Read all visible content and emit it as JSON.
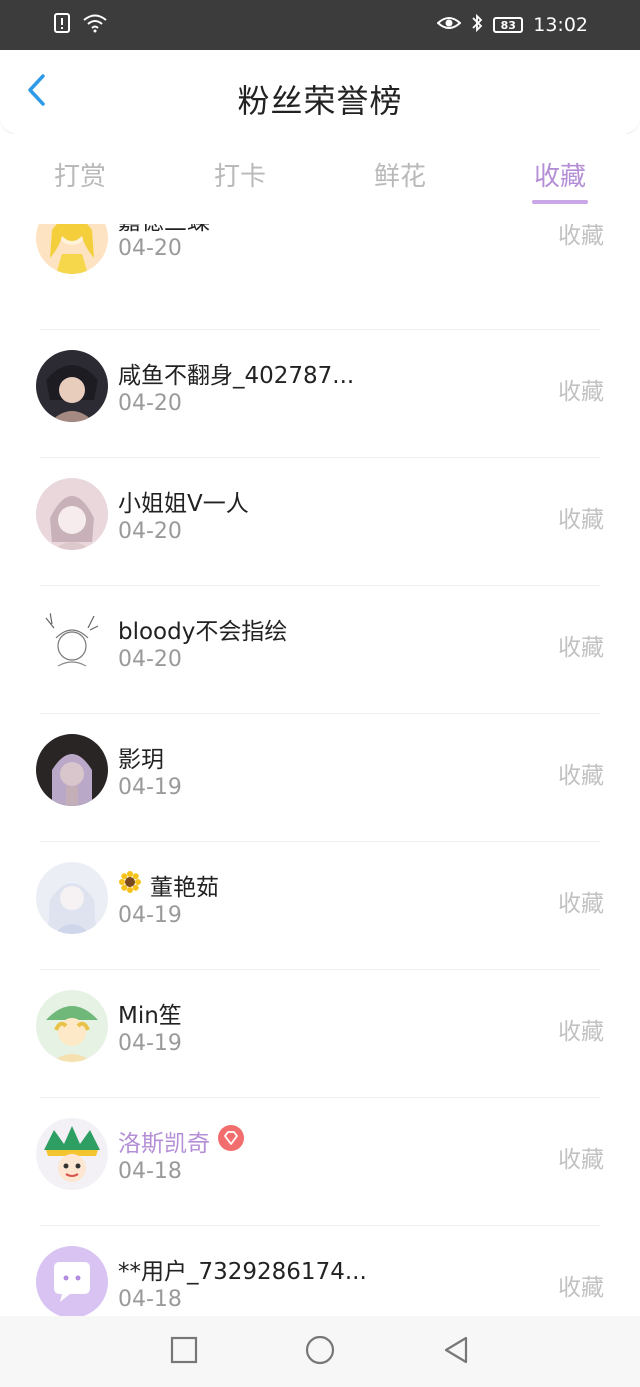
{
  "status_bar": {
    "time": "13:02",
    "battery": "83"
  },
  "header": {
    "title": "粉丝荣誉榜"
  },
  "tabs": [
    {
      "label": "打赏"
    },
    {
      "label": "打卡"
    },
    {
      "label": "鲜花"
    },
    {
      "label": "收藏"
    }
  ],
  "active_tab": "收藏",
  "colors": {
    "accent": "#b48fd6",
    "back_arrow": "#2f9be8"
  },
  "list": [
    {
      "name": "嘉德兰蝶",
      "date": "04-20",
      "action": "收藏"
    },
    {
      "name": "咸鱼不翻身_402787...",
      "date": "04-20",
      "action": "收藏"
    },
    {
      "name": "小姐姐V一人",
      "date": "04-20",
      "action": "收藏"
    },
    {
      "name": "bloody不会指绘",
      "date": "04-20",
      "action": "收藏"
    },
    {
      "name": "影玥",
      "date": "04-19",
      "action": "收藏"
    },
    {
      "name": "董艳茹",
      "date": "04-19",
      "action": "收藏"
    },
    {
      "name": "Min笙",
      "date": "04-19",
      "action": "收藏"
    },
    {
      "name": "洛斯凯奇",
      "date": "04-18",
      "action": "收藏"
    },
    {
      "name": "**用户_7329286174...",
      "date": "04-18",
      "action": "收藏"
    }
  ]
}
